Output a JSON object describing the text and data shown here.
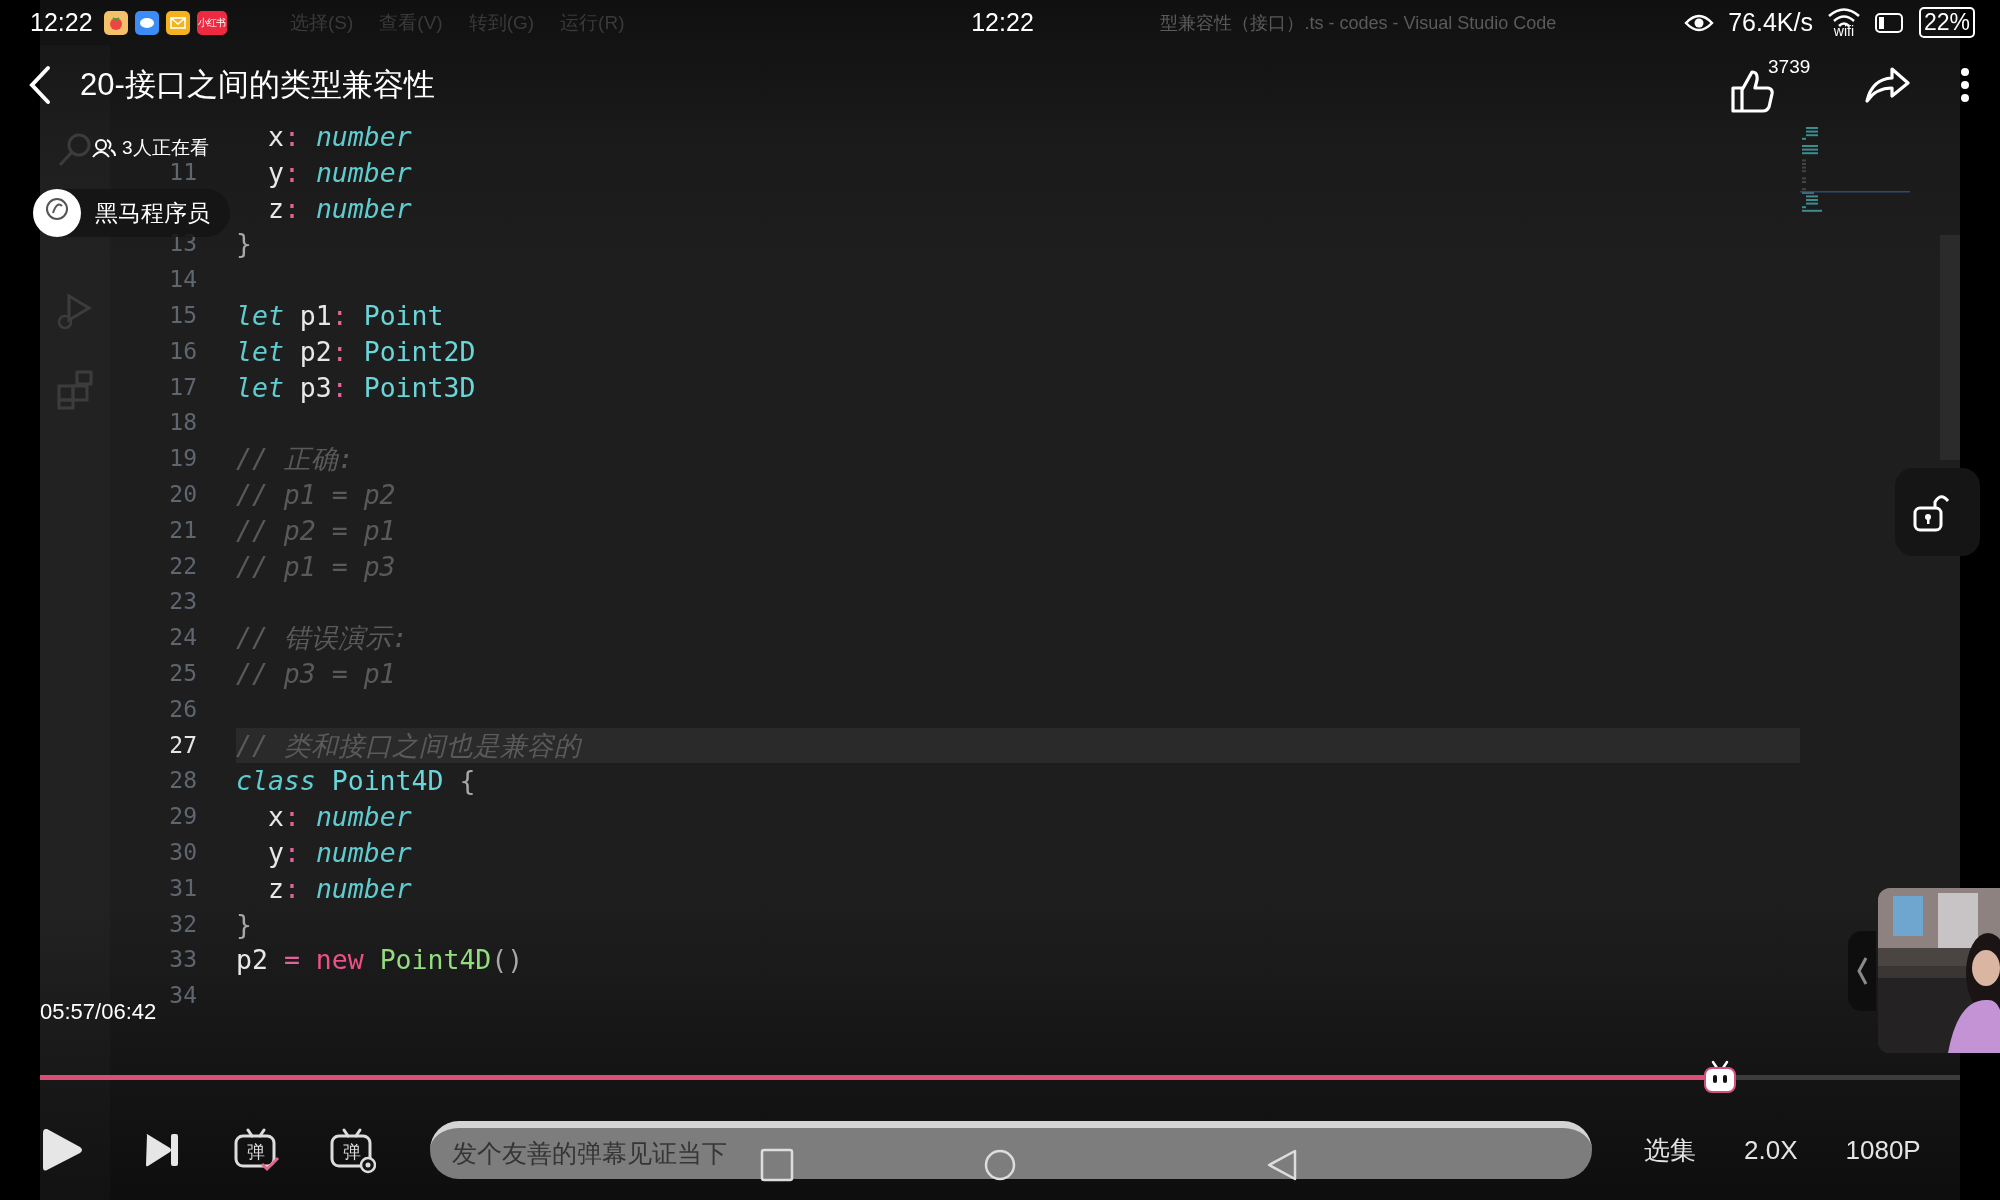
{
  "status_bar": {
    "time": "12:22",
    "apps": [
      {
        "kind": "tomato"
      },
      {
        "kind": "chat"
      },
      {
        "kind": "mail"
      },
      {
        "kind": "label",
        "label": "小红书"
      }
    ],
    "center_time": "12:22",
    "net_speed": "76.4K/s",
    "wifi_label": "wifi",
    "battery": "22%"
  },
  "video": {
    "editor": {
      "menu": [
        "选择(S)",
        "查看(V)",
        "转到(G)",
        "运行(R)"
      ],
      "window_title": "型兼容性（接口）.ts - codes - Visual Studio Code",
      "lines": [
        {
          "indented": true,
          "current": false,
          "tokens": [
            {
              "kind": "ident",
              "text": "x"
            },
            {
              "kind": "punct",
              "text": ": "
            },
            {
              "kind": "typei",
              "text": "number"
            }
          ]
        },
        {
          "number": "11",
          "indented": true,
          "current": false,
          "tokens": [
            {
              "kind": "ident",
              "text": "y"
            },
            {
              "kind": "punct",
              "text": ": "
            },
            {
              "kind": "typei",
              "text": "number"
            }
          ]
        },
        {
          "indented": true,
          "current": false,
          "tokens": [
            {
              "kind": "ident",
              "text": "z"
            },
            {
              "kind": "punct",
              "text": ": "
            },
            {
              "kind": "typei",
              "text": "number"
            }
          ]
        },
        {
          "number": "13",
          "indented": false,
          "current": false,
          "tokens": [
            {
              "kind": "brace",
              "text": "}"
            }
          ]
        },
        {
          "number": "14",
          "indented": false,
          "current": false
        },
        {
          "number": "15",
          "indented": false,
          "current": false,
          "tokens": [
            {
              "kind": "keyword",
              "text": "let "
            },
            {
              "kind": "ident",
              "text": "p1"
            },
            {
              "kind": "punct",
              "text": ": "
            },
            {
              "kind": "type",
              "text": "Point"
            }
          ]
        },
        {
          "number": "16",
          "indented": false,
          "current": false,
          "tokens": [
            {
              "kind": "keyword",
              "text": "let "
            },
            {
              "kind": "ident",
              "text": "p2"
            },
            {
              "kind": "punct",
              "text": ": "
            },
            {
              "kind": "type",
              "text": "Point2D"
            }
          ]
        },
        {
          "number": "17",
          "indented": false,
          "current": false,
          "tokens": [
            {
              "kind": "keyword",
              "text": "let "
            },
            {
              "kind": "ident",
              "text": "p3"
            },
            {
              "kind": "punct",
              "text": ": "
            },
            {
              "kind": "type",
              "text": "Point3D"
            }
          ]
        },
        {
          "number": "18",
          "indented": false,
          "current": false
        },
        {
          "number": "19",
          "indented": false,
          "current": false,
          "tokens": [
            {
              "kind": "comment",
              "text": "// 正确:"
            }
          ]
        },
        {
          "number": "20",
          "indented": false,
          "current": false,
          "tokens": [
            {
              "kind": "comment",
              "text": "// p1 = p2"
            }
          ]
        },
        {
          "number": "21",
          "indented": false,
          "current": false,
          "tokens": [
            {
              "kind": "comment",
              "text": "// p2 = p1"
            }
          ]
        },
        {
          "number": "22",
          "indented": false,
          "current": false,
          "tokens": [
            {
              "kind": "comment",
              "text": "// p1 = p3"
            }
          ]
        },
        {
          "number": "23",
          "indented": false,
          "current": false
        },
        {
          "number": "24",
          "indented": false,
          "current": false,
          "tokens": [
            {
              "kind": "comment",
              "text": "// 错误演示:"
            }
          ]
        },
        {
          "number": "25",
          "indented": false,
          "current": false,
          "tokens": [
            {
              "kind": "comment",
              "text": "// p3 = p1"
            }
          ]
        },
        {
          "number": "26",
          "indented": false,
          "current": false
        },
        {
          "number": "27",
          "indented": false,
          "current": true,
          "tokens": [
            {
              "kind": "comment",
              "text": "// 类和接口之间也是兼容的"
            }
          ]
        },
        {
          "number": "28",
          "indented": false,
          "current": false,
          "tokens": [
            {
              "kind": "keyword",
              "text": "class "
            },
            {
              "kind": "type",
              "text": "Point4D "
            },
            {
              "kind": "brace",
              "text": "{"
            }
          ]
        },
        {
          "number": "29",
          "indented": true,
          "current": false,
          "tokens": [
            {
              "kind": "ident",
              "text": "x"
            },
            {
              "kind": "punct",
              "text": ": "
            },
            {
              "kind": "typei",
              "text": "number"
            }
          ]
        },
        {
          "number": "30",
          "indented": true,
          "current": false,
          "tokens": [
            {
              "kind": "ident",
              "text": "y"
            },
            {
              "kind": "punct",
              "text": ": "
            },
            {
              "kind": "typei",
              "text": "number"
            }
          ]
        },
        {
          "number": "31",
          "indented": true,
          "current": false,
          "tokens": [
            {
              "kind": "ident",
              "text": "z"
            },
            {
              "kind": "punct",
              "text": ": "
            },
            {
              "kind": "typei",
              "text": "number"
            }
          ]
        },
        {
          "number": "32",
          "indented": false,
          "current": false,
          "tokens": [
            {
              "kind": "brace",
              "text": "}"
            }
          ]
        },
        {
          "number": "33",
          "indented": false,
          "current": false,
          "tokens": [
            {
              "kind": "ident",
              "text": "p2 "
            },
            {
              "kind": "operator",
              "text": "= "
            },
            {
              "kind": "new",
              "text": "new "
            },
            {
              "kind": "call",
              "text": "Point4D"
            },
            {
              "kind": "brace",
              "text": "()"
            }
          ]
        },
        {
          "number": "34",
          "indented": false,
          "current": false
        }
      ]
    }
  },
  "player": {
    "title": "20-接口之间的类型兼容性",
    "viewers": "3人正在看",
    "uploader": "黑马程序员",
    "likes": "3739",
    "screen_lock": {
      "locked": false
    },
    "time": "05:57/06:42",
    "progress": {
      "level": 0.875
    },
    "danmaku_buttons": [
      {
        "kind": "toggle",
        "glyph": "弹"
      },
      {
        "kind": "settings",
        "glyph": "弹"
      }
    ],
    "danmaku_input": {
      "placeholder": "发个友善的弹幕见证当下"
    },
    "options": [
      "选集",
      "2.0X",
      "1080P"
    ]
  }
}
